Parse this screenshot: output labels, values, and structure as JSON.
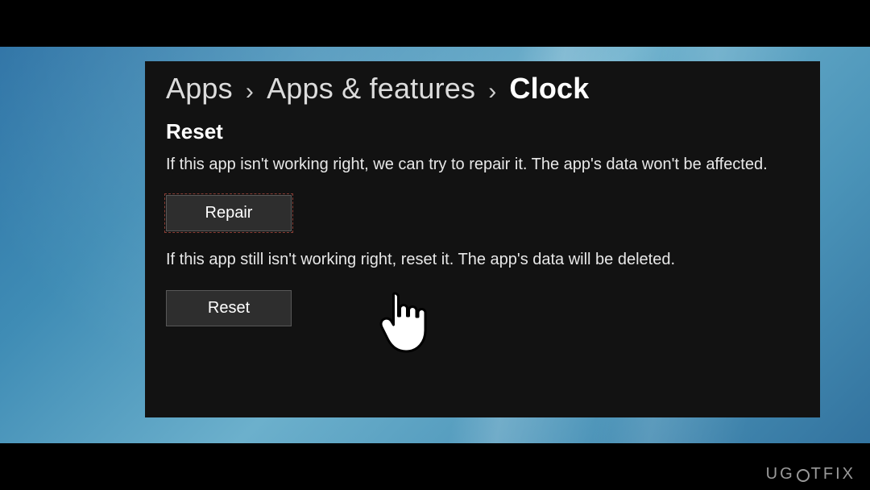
{
  "breadcrumb": {
    "item1": "Apps",
    "item2": "Apps & features",
    "item3": "Clock",
    "separator": "›"
  },
  "reset_section": {
    "heading": "Reset",
    "repair_desc": "If this app isn't working right, we can try to repair it. The app's data won't be affected.",
    "repair_button": "Repair",
    "reset_desc": "If this app still isn't working right, reset it. The app's data will be deleted.",
    "reset_button": "Reset"
  },
  "watermark": {
    "pre": "UG",
    "post": "TFIX"
  }
}
